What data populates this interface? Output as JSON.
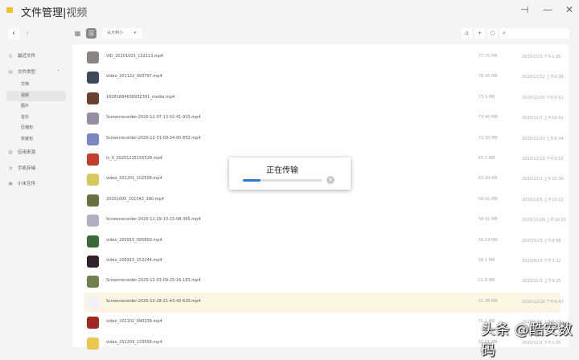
{
  "header": {
    "app": "文件管理",
    "sep": "|",
    "section": "视频",
    "pin": "⊣",
    "min": "—",
    "close": "✕"
  },
  "toolbar": {
    "back": "‹",
    "forward": "›",
    "grid": "▦",
    "list": "☰",
    "sort": "从大到小",
    "sort_arrow": "▾",
    "upload": "⌂",
    "add": "+",
    "refresh": "○",
    "search_icon": "⌕",
    "search_placeholder": ""
  },
  "sidebar": [
    {
      "label": "最近文件",
      "icon": "◎"
    },
    {
      "label": "文件类型",
      "icon": "▤",
      "arrow": "˄"
    },
    {
      "label": "文档",
      "child": true
    },
    {
      "label": "视频",
      "child": true,
      "selected": true
    },
    {
      "label": "图片",
      "child": true
    },
    {
      "label": "音乐",
      "child": true
    },
    {
      "label": "压缩包",
      "child": true
    },
    {
      "label": "安装包",
      "child": true
    },
    {
      "label": "应用来源",
      "icon": "▥"
    },
    {
      "label": "手机存储",
      "icon": "◔"
    },
    {
      "label": "小米互传",
      "icon": "▣"
    }
  ],
  "files": [
    {
      "name": "VID_20201003_132113.mp4",
      "size": "77.75 MB",
      "date": "2020/10/3 下午1:26",
      "color": "#8a8580"
    },
    {
      "name": "video_201122_093797.mp4",
      "size": "76.45 MB",
      "date": "2020/11/22 上午9:38",
      "color": "#3e4a5a"
    },
    {
      "name": "1608188463893Z391_media.mp4",
      "size": "73.5 MB",
      "date": "2020/12/30 下午5:51",
      "color": "#6a4030"
    },
    {
      "name": "Screenrecorder-2020-12-07-13-02-41-915.mp4",
      "size": "73.46 MB",
      "date": "2020/12/7 上午10:02",
      "color": "#9a8ca0"
    },
    {
      "name": "Screenrecorder-2020-12-31-09-34-00-852.mp4",
      "size": "72.30 MB",
      "date": "2020/12/31 上午9:34",
      "color": "#7a86c0"
    },
    {
      "name": "lv_0_20201225155528.mp4",
      "size": "65.5 MB",
      "date": "2020/12/25 下午3:55",
      "color": "#c04030"
    },
    {
      "name": "video_201201_102508.mp4",
      "size": "63.94 MB",
      "date": "2020/12/1 上午10:30",
      "color": "#d8c860"
    },
    {
      "name": "20201005_101042_280.mp4",
      "size": "58.91 MB",
      "date": "2020/10/5 上午10:12",
      "color": "#6a7040"
    },
    {
      "name": "Screenrecorder-2020-11-29-10-15-08-365.mp4",
      "size": "58.41 MB",
      "date": "2020/11/29 上午10:15",
      "color": "#b0b0c0"
    },
    {
      "name": "video_200915_095800.mp4",
      "size": "56.19 MB",
      "date": "2020/9/15 上午9:58",
      "color": "#3a6a3a"
    },
    {
      "name": "video_200915_153244.mp4",
      "size": "56.1 MB",
      "date": "2020/9/15 下午3:32",
      "color": "#302030"
    },
    {
      "name": "Screenrecorder-2020-12-03-09-25-16-183.mp4",
      "size": "51.8 MB",
      "date": "2020/12/3 上午9:25",
      "color": "#708050"
    },
    {
      "name": "Screenrecorder-2020-12-28-21-43-42-630.mp4",
      "size": "51.38 MB",
      "date": "2020/12/28 下午9:43",
      "color": "#f0f0f8",
      "highlight": true
    },
    {
      "name": "video_201102_090339.mp4",
      "size": "51.1 MB",
      "date": "2020/11/2 上午9:03",
      "color": "#a02820"
    },
    {
      "name": "video_201203_133558.mp4",
      "size": "51.01 MB",
      "date": "2020/12/3 下午1:35",
      "color": "#e8c850"
    }
  ],
  "dialog": {
    "title": "正在传输",
    "progress": 0.22,
    "cancel": "✕"
  },
  "watermark": "头条 @酷安数码"
}
